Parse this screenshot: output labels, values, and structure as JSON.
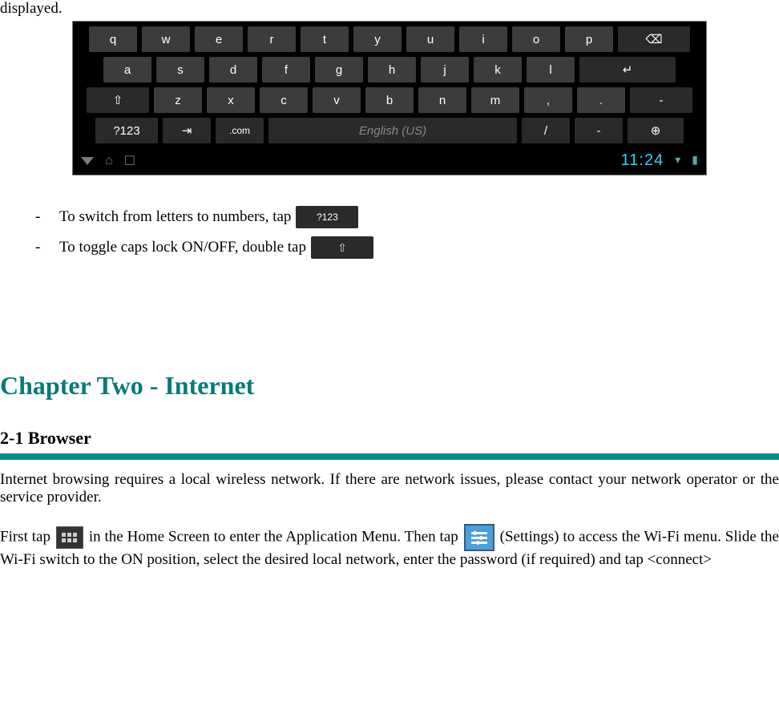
{
  "top_word": "displayed.",
  "keyboard": {
    "row1": [
      "q",
      "w",
      "e",
      "r",
      "t",
      "y",
      "u",
      "i",
      "o",
      "p"
    ],
    "row1_backspace_glyph": "⌫",
    "row2": [
      "a",
      "s",
      "d",
      "f",
      "g",
      "h",
      "j",
      "k",
      "l"
    ],
    "row2_enter_glyph": "↵",
    "row3_shift_glyph": "⇧",
    "row3": [
      "z",
      "x",
      "c",
      "v",
      "b",
      "n",
      "m",
      ",",
      "."
    ],
    "row3_last": "-",
    "row4": {
      "sym": "?123",
      "tab_glyph": "⇥",
      "com": ".com",
      "space_label": "English (US)",
      "slash": "/",
      "dash": "-",
      "lang_glyph": "⊕"
    },
    "navbar": {
      "back_glyph": "▽",
      "home_glyph": "⌂",
      "recent_glyph": "☐",
      "clock": "11:24",
      "wifi_glyph": "▾",
      "batt_glyph": "▮"
    }
  },
  "bullets": {
    "b1_text": "To switch from letters to numbers, tap",
    "b1_key": "?123",
    "b2_text": "To toggle caps lock ON/OFF, double tap",
    "b2_key": "⇧"
  },
  "chapter_title": "Chapter Two - Internet",
  "section_title": "2-1 Browser",
  "para1": "Internet browsing requires a local wireless network. If there are network issues, please contact your network operator or the service provider.",
  "para2_a": "First tap ",
  "para2_b": " in the Home Screen to enter the Application Menu.   Then tap ",
  "para2_c": " (Settings) to access the Wi-Fi menu.   Slide the Wi-Fi switch to the ON position, select the desired local network, enter the password (if required) and tap <connect>"
}
